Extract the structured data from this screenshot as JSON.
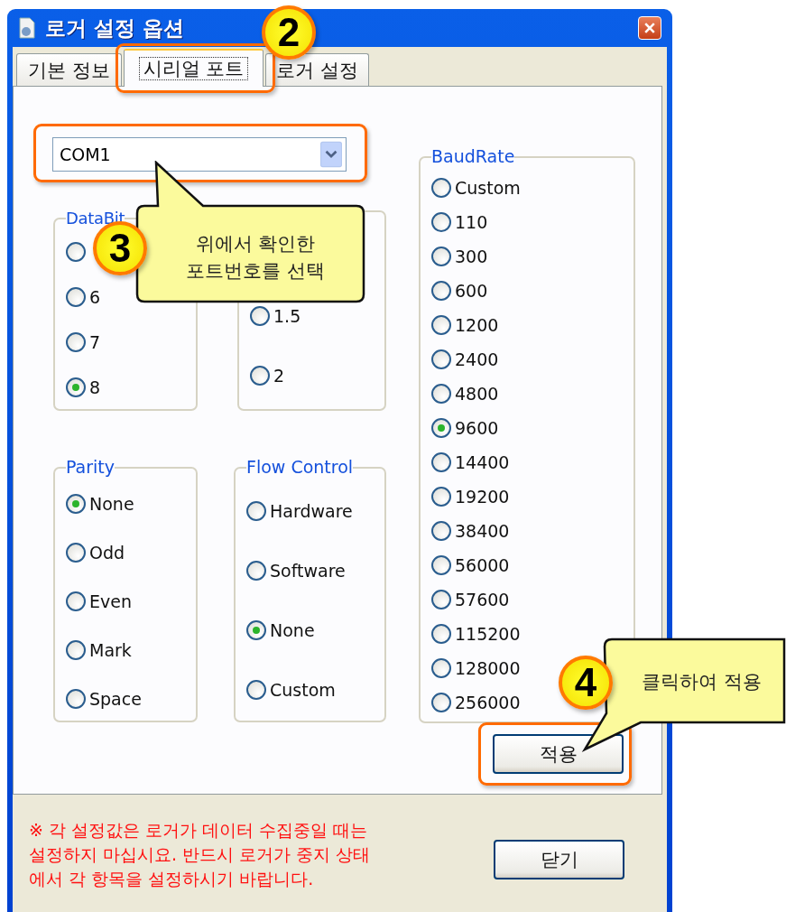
{
  "window": {
    "title": "로거 설정 옵션"
  },
  "tabs": [
    {
      "label": "기본 정보",
      "selected": false
    },
    {
      "label": "시리얼 포트",
      "selected": true
    },
    {
      "label": "로거 설정",
      "selected": false
    }
  ],
  "port_select": {
    "value": "COM1"
  },
  "groups": [
    {
      "title": "DataBit",
      "options": [
        {
          "selected": false
        },
        {
          "label": "6",
          "selected": false
        },
        {
          "label": "7",
          "selected": false
        },
        {
          "label": "8",
          "selected": true
        }
      ]
    },
    {
      "options": [
        {
          "label": "1.5",
          "selected": false
        },
        {
          "label": "2",
          "selected": false
        }
      ]
    },
    {
      "title": "Parity",
      "options": [
        {
          "label": "None",
          "selected": true
        },
        {
          "label": "Odd",
          "selected": false
        },
        {
          "label": "Even",
          "selected": false
        },
        {
          "label": "Mark",
          "selected": false
        },
        {
          "label": "Space",
          "selected": false
        }
      ]
    },
    {
      "title": "Flow Control",
      "options": [
        {
          "label": "Hardware",
          "selected": false
        },
        {
          "label": "Software",
          "selected": false
        },
        {
          "label": "None",
          "selected": true
        },
        {
          "label": "Custom",
          "selected": false
        }
      ]
    }
  ],
  "baud_rate": {
    "title": "BaudRate",
    "options": [
      {
        "label": "Custom",
        "selected": false
      },
      {
        "label": "110",
        "selected": false
      },
      {
        "label": "300",
        "selected": false
      },
      {
        "label": "600",
        "selected": false
      },
      {
        "label": "1200",
        "selected": false
      },
      {
        "label": "2400",
        "selected": false
      },
      {
        "label": "4800",
        "selected": false
      },
      {
        "label": "9600",
        "selected": true
      },
      {
        "label": "14400",
        "selected": false
      },
      {
        "label": "19200",
        "selected": false
      },
      {
        "label": "38400",
        "selected": false
      },
      {
        "label": "56000",
        "selected": false
      },
      {
        "label": "57600",
        "selected": false
      },
      {
        "label": "115200",
        "selected": false
      },
      {
        "label": "128000",
        "selected": false
      },
      {
        "label": "256000",
        "selected": false
      }
    ]
  },
  "apply_button": "적용",
  "notice": [
    "※ 각 설정값은 로거가 데이터 수집중일 때는",
    "설정하지 마십시요. 반드시 로거가 중지 상태",
    "에서 각 항목을 설정하시기 바랍니다."
  ],
  "close_button": "닫기",
  "annotations": [
    {
      "number": "2"
    },
    {
      "number": "3",
      "text": [
        "위에서 확인한",
        "포트번호를 선택"
      ]
    },
    {
      "number": "4",
      "text": [
        "클릭하여 적용"
      ]
    }
  ]
}
